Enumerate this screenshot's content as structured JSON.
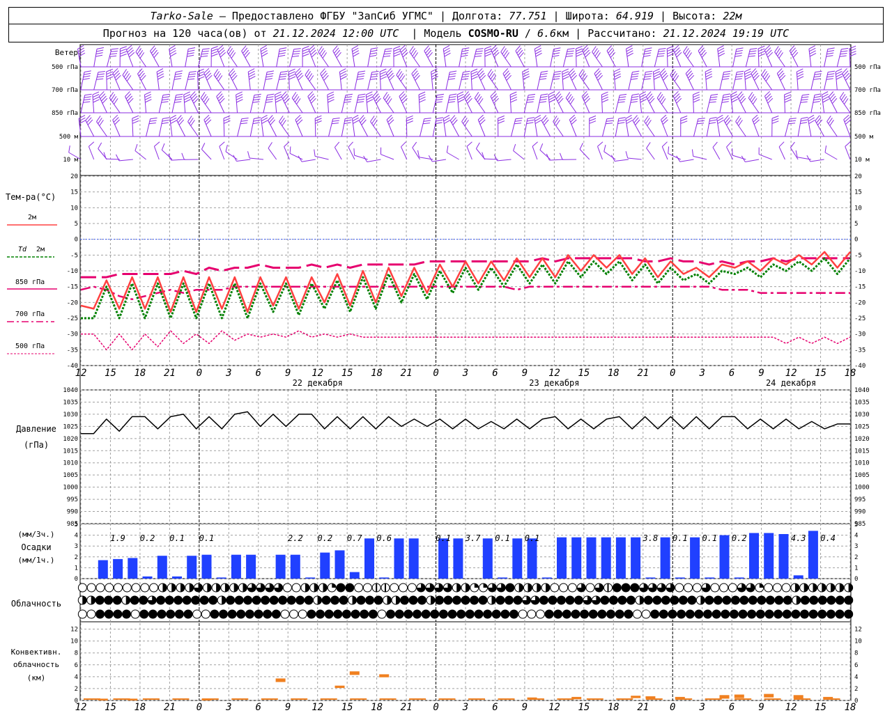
{
  "header": {
    "station": "Tarko-Sale",
    "dash": " – Предоставлено ФГБУ \"ЗапСиб УГМС\" | Долгота: ",
    "lon": "77.751",
    "sep_lat": " | Широта: ",
    "lat": "64.919",
    "sep_alt": " | Высота: ",
    "alt": "22м",
    "forecast_prefix": "Прогноз на 120 часа(ов) от ",
    "forecast_time": "21.12.2024 12:00 UTC",
    "model_prefix": "  | Модель ",
    "model": "COSMO-RU",
    "model_sep": " / ",
    "resolution": "6.6",
    "res_unit": "км | Рассчитано: ",
    "calc_time": "21.12.2024 19:19 UTC"
  },
  "labels": {
    "wind_title": "Ветер",
    "wind_levels": [
      "500 гПа",
      "700 гПа",
      "850 гПа",
      "500 м",
      "10  м"
    ],
    "temp_title": "Тем-ра(°С)",
    "t2m": "2м",
    "td": "Td",
    "td_2m": "2м",
    "t850": "850 гПа",
    "t700": "700 гПа",
    "t500": "500 гПа",
    "pressure_title": "Давление",
    "pressure_unit": "(гПа)",
    "precip_unit3": "(мм/3ч.)",
    "precip_title": "Осадки",
    "precip_unit1": "(мм/1ч.)",
    "cloud_title": "Облачность",
    "conv_title1": "Конвективн.",
    "conv_title2": "облачность",
    "conv_unit": "(км)"
  },
  "colors": {
    "wind": "#8a2be2",
    "t2m": "#ff4040",
    "td": "#008000",
    "t850": "#e6006e",
    "t700": "#e6006e",
    "t500": "#e6006e",
    "zero_line": "#4060ff",
    "pressure": "#000000",
    "precip_bar": "#2040ff",
    "conv": "#f08020",
    "grid": "#a0a0a0"
  },
  "chart_data": {
    "type": "line",
    "time_step_hours": 3,
    "x_tick_labels": [
      "12",
      "15",
      "18",
      "21",
      "0",
      "3",
      "6",
      "9",
      "12",
      "15",
      "18",
      "21",
      "0",
      "3",
      "6",
      "9",
      "12",
      "15",
      "18",
      "21",
      "0",
      "3",
      "6",
      "9",
      "12",
      "15",
      "18"
    ],
    "day_labels": [
      "22 декабря",
      "23 декабря",
      "24 декабря"
    ],
    "temperature": {
      "ylim": [
        -40,
        20
      ],
      "ticks": [
        20,
        15,
        10,
        5,
        0,
        -5,
        -10,
        -15,
        -20,
        -25,
        -30,
        -35,
        -40
      ],
      "series": [
        {
          "name": "2м",
          "values": [
            -21,
            -22,
            -13,
            -22,
            -12,
            -22,
            -12,
            -23,
            -12,
            -23,
            -12,
            -22,
            -12,
            -23,
            -12,
            -21,
            -12,
            -22,
            -12,
            -20,
            -11,
            -21,
            -10,
            -20,
            -9,
            -18,
            -9,
            -17,
            -8,
            -15,
            -7,
            -14,
            -7,
            -13,
            -6,
            -12,
            -6,
            -12,
            -5,
            -10,
            -5,
            -9,
            -5,
            -11,
            -6,
            -12,
            -7,
            -11,
            -9,
            -12,
            -8,
            -9,
            -7,
            -10,
            -6,
            -8,
            -5,
            -8,
            -4,
            -9,
            -4
          ]
        },
        {
          "name": "Td 2м",
          "values": [
            -25,
            -25,
            -15,
            -25,
            -14,
            -25,
            -14,
            -25,
            -14,
            -25,
            -14,
            -25,
            -14,
            -25,
            -14,
            -23,
            -14,
            -24,
            -14,
            -22,
            -13,
            -23,
            -12,
            -22,
            -11,
            -20,
            -11,
            -19,
            -10,
            -17,
            -9,
            -16,
            -9,
            -15,
            -8,
            -14,
            -8,
            -14,
            -7,
            -12,
            -7,
            -11,
            -7,
            -13,
            -8,
            -14,
            -9,
            -13,
            -11,
            -14,
            -10,
            -11,
            -9,
            -12,
            -8,
            -10,
            -7,
            -10,
            -6,
            -11,
            -6
          ]
        },
        {
          "name": "850 гПа",
          "values": [
            -12,
            -12,
            -12,
            -11,
            -11,
            -11,
            -11,
            -11,
            -10,
            -11,
            -9,
            -10,
            -9,
            -9,
            -8,
            -9,
            -9,
            -9,
            -8,
            -9,
            -8,
            -9,
            -8,
            -8,
            -8,
            -8,
            -8,
            -7,
            -7,
            -7,
            -7,
            -7,
            -7,
            -7,
            -7,
            -7,
            -6,
            -7,
            -6,
            -6,
            -6,
            -6,
            -6,
            -6,
            -7,
            -7,
            -6,
            -7,
            -7,
            -8,
            -7,
            -8,
            -7,
            -7,
            -6,
            -7,
            -6,
            -6,
            -6,
            -6,
            -6
          ]
        },
        {
          "name": "700 гПа",
          "values": [
            -16,
            -15,
            -16,
            -18,
            -19,
            -18,
            -17,
            -16,
            -17,
            -16,
            -16,
            -16,
            -15,
            -15,
            -15,
            -15,
            -15,
            -15,
            -15,
            -15,
            -15,
            -15,
            -15,
            -15,
            -15,
            -15,
            -15,
            -15,
            -15,
            -15,
            -15,
            -15,
            -15,
            -15,
            -16,
            -15,
            -15,
            -15,
            -15,
            -15,
            -15,
            -15,
            -15,
            -15,
            -15,
            -15,
            -15,
            -15,
            -15,
            -15,
            -16,
            -16,
            -16,
            -17,
            -17,
            -17,
            -17,
            -17,
            -17,
            -17,
            -17
          ]
        },
        {
          "name": "500 гПа",
          "values": [
            -30,
            -30,
            -35,
            -30,
            -35,
            -30,
            -34,
            -29,
            -33,
            -30,
            -33,
            -29,
            -32,
            -30,
            -31,
            -30,
            -31,
            -29,
            -31,
            -30,
            -31,
            -30,
            -31,
            -31,
            -31,
            -31,
            -31,
            -31,
            -31,
            -31,
            -31,
            -31,
            -31,
            -31,
            -31,
            -31,
            -31,
            -31,
            -31,
            -31,
            -31,
            -31,
            -31,
            -31,
            -31,
            -31,
            -31,
            -31,
            -31,
            -31,
            -31,
            -31,
            -31,
            -31,
            -31,
            -33,
            -31,
            -33,
            -31,
            -33,
            -31
          ]
        }
      ]
    },
    "pressure": {
      "ylim": [
        985,
        1040
      ],
      "ticks": [
        1040,
        1035,
        1030,
        1025,
        1020,
        1015,
        1010,
        1005,
        1000,
        995,
        990,
        985
      ],
      "values": [
        1022,
        1022,
        1028,
        1023,
        1029,
        1029,
        1024,
        1029,
        1030,
        1024,
        1029,
        1024,
        1030,
        1031,
        1025,
        1030,
        1025,
        1030,
        1030,
        1024,
        1029,
        1024,
        1029,
        1024,
        1029,
        1025,
        1028,
        1025,
        1028,
        1024,
        1028,
        1024,
        1027,
        1024,
        1028,
        1024,
        1028,
        1029,
        1024,
        1028,
        1024,
        1028,
        1029,
        1024,
        1029,
        1024,
        1029,
        1024,
        1029,
        1024,
        1029,
        1029,
        1024,
        1028,
        1024,
        1028,
        1024,
        1027,
        1024,
        1026,
        1026
      ]
    },
    "precipitation": {
      "ylim": [
        0,
        5
      ],
      "ticks": [
        5,
        4,
        3,
        2,
        1,
        0
      ],
      "bars": [
        {
          "i": 1,
          "v": 1.7
        },
        {
          "i": 2,
          "v": 1.8
        },
        {
          "i": 3,
          "v": 1.9
        },
        {
          "i": 4,
          "v": 0.2
        },
        {
          "i": 5,
          "v": 2.1
        },
        {
          "i": 6,
          "v": 0.2
        },
        {
          "i": 7,
          "v": 2.1
        },
        {
          "i": 8,
          "v": 2.2
        },
        {
          "i": 9,
          "v": 0.1
        },
        {
          "i": 10,
          "v": 2.2
        },
        {
          "i": 11,
          "v": 2.2
        },
        {
          "i": 13,
          "v": 2.2
        },
        {
          "i": 14,
          "v": 2.2
        },
        {
          "i": 15,
          "v": 0.1
        },
        {
          "i": 16,
          "v": 2.4
        },
        {
          "i": 17,
          "v": 2.6
        },
        {
          "i": 18,
          "v": 0.6
        },
        {
          "i": 19,
          "v": 3.7
        },
        {
          "i": 20,
          "v": 0.1
        },
        {
          "i": 21,
          "v": 3.7
        },
        {
          "i": 22,
          "v": 3.7
        },
        {
          "i": 24,
          "v": 3.7
        },
        {
          "i": 25,
          "v": 3.7
        },
        {
          "i": 27,
          "v": 3.7
        },
        {
          "i": 28,
          "v": 0.1
        },
        {
          "i": 29,
          "v": 3.7
        },
        {
          "i": 30,
          "v": 3.7
        },
        {
          "i": 31,
          "v": 0.1
        },
        {
          "i": 32,
          "v": 3.8
        },
        {
          "i": 33,
          "v": 3.8
        },
        {
          "i": 34,
          "v": 3.8
        },
        {
          "i": 35,
          "v": 3.8
        },
        {
          "i": 36,
          "v": 3.8
        },
        {
          "i": 37,
          "v": 3.8
        },
        {
          "i": 38,
          "v": 0.1
        },
        {
          "i": 39,
          "v": 3.8
        },
        {
          "i": 40,
          "v": 0.1
        },
        {
          "i": 41,
          "v": 3.8
        },
        {
          "i": 42,
          "v": 0.1
        },
        {
          "i": 43,
          "v": 4.0
        },
        {
          "i": 44,
          "v": 0.1
        },
        {
          "i": 45,
          "v": 4.2
        },
        {
          "i": 46,
          "v": 4.2
        },
        {
          "i": 47,
          "v": 4.1
        },
        {
          "i": 48,
          "v": 0.3
        },
        {
          "i": 49,
          "v": 4.4
        }
      ],
      "sum3h_labels": [
        {
          "i": 2.5,
          "t": "1.9"
        },
        {
          "i": 4.5,
          "t": "0.2"
        },
        {
          "i": 6.5,
          "t": "0.1"
        },
        {
          "i": 8.5,
          "t": "0.1"
        },
        {
          "i": 14.5,
          "t": "2.2"
        },
        {
          "i": 16.5,
          "t": "0.2"
        },
        {
          "i": 18.5,
          "t": "0.7"
        },
        {
          "i": 20.5,
          "t": "0.6"
        },
        {
          "i": 24.5,
          "t": "0.1"
        },
        {
          "i": 26.5,
          "t": "3.7"
        },
        {
          "i": 28.5,
          "t": "0.1"
        },
        {
          "i": 30.5,
          "t": "0.1"
        },
        {
          "i": 38.5,
          "t": "3.8"
        },
        {
          "i": 40.5,
          "t": "0.1"
        },
        {
          "i": 42.5,
          "t": "0.1"
        },
        {
          "i": 44.5,
          "t": "0.2"
        },
        {
          "i": 48.5,
          "t": "4.3"
        },
        {
          "i": 50.5,
          "t": "0.4"
        }
      ]
    },
    "convective_cloud": {
      "ylim": [
        0,
        13
      ],
      "ticks": [
        12,
        10,
        8,
        6,
        4,
        2,
        0
      ],
      "segments": [
        {
          "i": 1,
          "bottom": 0,
          "top": 0.3
        },
        {
          "i": 3,
          "bottom": 0,
          "top": 0.3
        },
        {
          "i": 8,
          "bottom": 0,
          "top": 0.3
        },
        {
          "i": 13,
          "bottom": 3.1,
          "top": 3.7
        },
        {
          "i": 17,
          "bottom": 2.1,
          "top": 2.5
        },
        {
          "i": 18,
          "bottom": 4.3,
          "top": 4.9
        },
        {
          "i": 20,
          "bottom": 3.9,
          "top": 4.4
        },
        {
          "i": 30,
          "bottom": 0.2,
          "top": 0.5
        },
        {
          "i": 33,
          "bottom": 0.2,
          "top": 0.6
        },
        {
          "i": 37,
          "bottom": 0.4,
          "top": 0.8
        },
        {
          "i": 38,
          "bottom": 0.3,
          "top": 0.7
        },
        {
          "i": 40,
          "bottom": 0.2,
          "top": 0.6
        },
        {
          "i": 43,
          "bottom": 0.3,
          "top": 0.9
        },
        {
          "i": 44,
          "bottom": 0.4,
          "top": 1.0
        },
        {
          "i": 46,
          "bottom": 0.5,
          "top": 1.1
        },
        {
          "i": 48,
          "bottom": 0.3,
          "top": 0.9
        },
        {
          "i": 50,
          "bottom": 0.2,
          "top": 0.6
        }
      ]
    },
    "cloud_rows": [
      "ooooooooohhhhqhhhhhqqqqoohhhtffooccoooqqqqhhttqqfhhhhoooqoqcfffqqqqoooqoooqqtooohhhhhhh",
      "hhfffhffqfffffffhffffffffffhfffhfffhhfffhffffffhfffqqfffffqqffffhffffffhffffffffffhffffff",
      "ooffffoffffffooffffffffoooffffffffofffffffffffffffoooffffffffffoofffffffffffffffffffffff"
    ],
    "wind_barbs": {
      "levels": [
        "500 гПа",
        "700 гПа",
        "850 гПа",
        "500 м",
        "10  м"
      ]
    }
  }
}
